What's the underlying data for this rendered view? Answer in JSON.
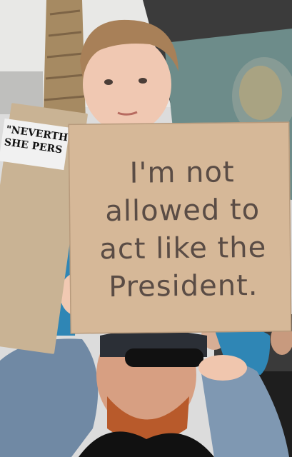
{
  "photo": {
    "main_sign_lines": [
      "I'm not",
      "allowed to",
      "act like the",
      "President."
    ],
    "background_sign_lines": [
      "\"NEVERTH",
      "SHE PERS"
    ]
  }
}
